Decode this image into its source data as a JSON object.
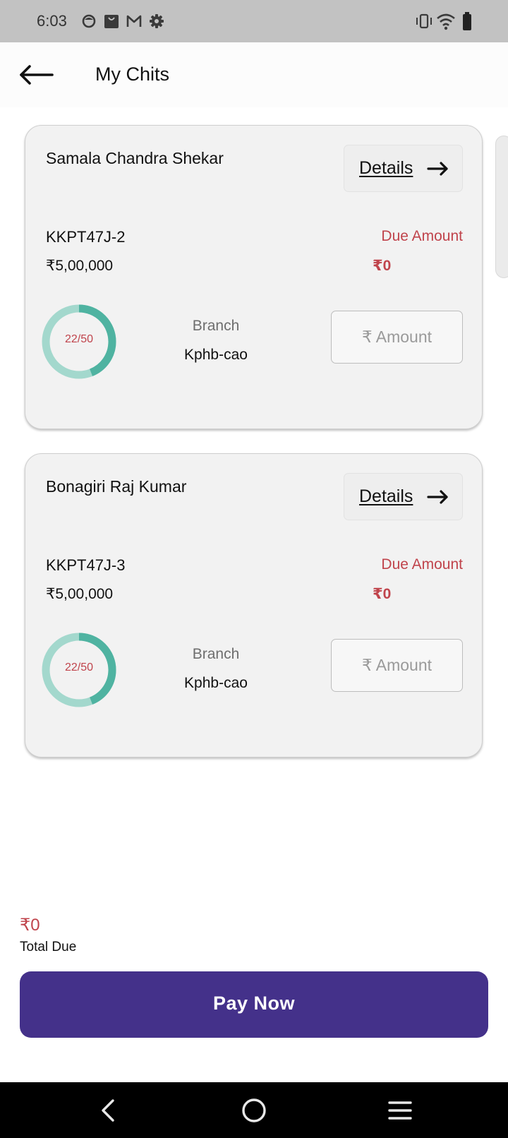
{
  "status_bar": {
    "time": "6:03",
    "left_icons": [
      "face-icon",
      "shopping-bag-icon",
      "gmail-icon",
      "gear-icon"
    ],
    "right_icons": [
      "vibrate-icon",
      "wifi-icon",
      "battery-icon"
    ]
  },
  "app_bar": {
    "back_icon": "back-arrow-icon",
    "title": "My Chits"
  },
  "chits": [
    {
      "name": "Samala Chandra Shekar",
      "details_label": "Details",
      "chit_id": "KKPT47J-2",
      "chit_value": "₹5,00,000",
      "due_label": "Due Amount",
      "due_value": "₹0",
      "progress_text": "22/50",
      "progress_fraction": 0.44,
      "branch_label": "Branch",
      "branch_value": "Kphb-cao",
      "amount_placeholder": "₹ Amount"
    },
    {
      "name": "Bonagiri Raj Kumar",
      "details_label": "Details",
      "chit_id": "KKPT47J-3",
      "chit_value": "₹5,00,000",
      "due_label": "Due Amount",
      "due_value": "₹0",
      "progress_text": "22/50",
      "progress_fraction": 0.44,
      "branch_label": "Branch",
      "branch_value": "Kphb-cao",
      "amount_placeholder": "₹ Amount"
    }
  ],
  "footer": {
    "total_due_value": "₹0",
    "total_due_label": "Total Due",
    "pay_button_label": "Pay Now"
  },
  "nav_bar": {
    "icons": [
      "nav-back-icon",
      "nav-home-icon",
      "nav-menu-icon"
    ]
  },
  "colors": {
    "accent": "#44318a",
    "due_red": "#c0444c",
    "ring_track": "#a3d8cd",
    "ring_progress": "#4fb3a1"
  }
}
